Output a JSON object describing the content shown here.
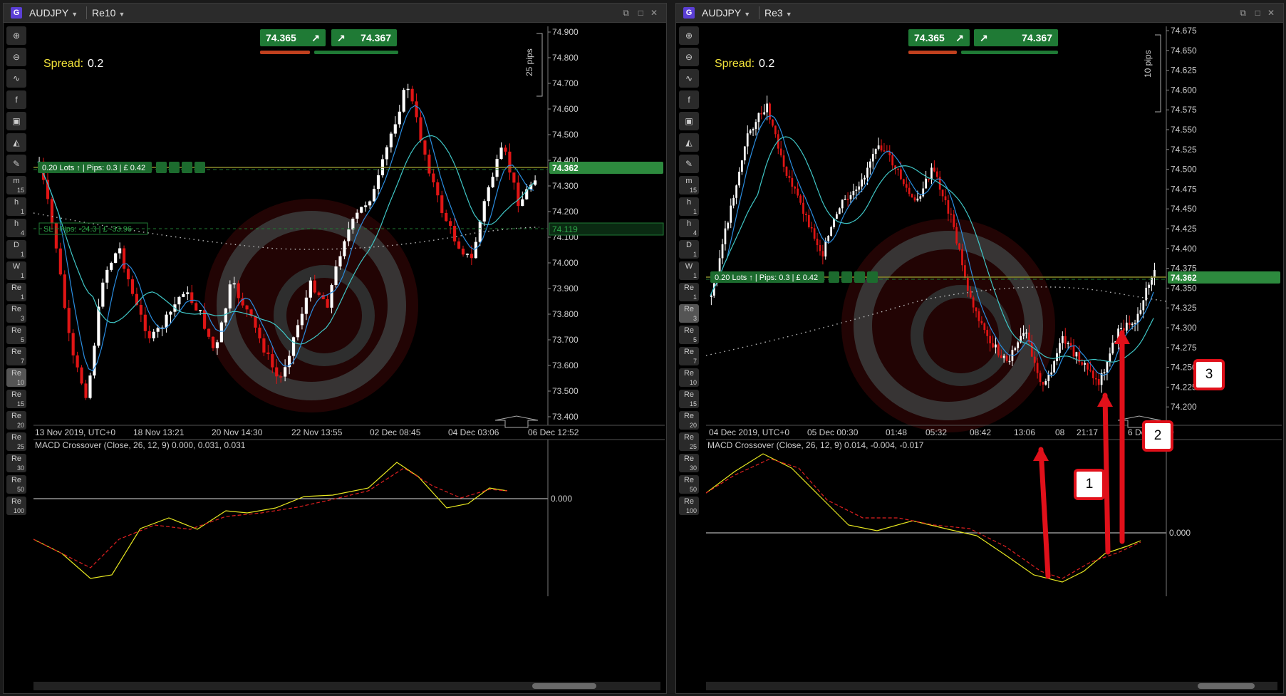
{
  "left": {
    "symbol": "AUDJPY",
    "timeframe": "Re10",
    "bid": "74.365",
    "ask": "74.367",
    "spread_label": "Spread:",
    "spread_value": "0.2",
    "pips_ruler": "25 pips",
    "price_ticks": [
      "74.900",
      "74.800",
      "74.700",
      "74.600",
      "74.500",
      "74.400",
      "74.300",
      "74.200",
      "74.100",
      "74.000",
      "73.900",
      "73.800",
      "73.700",
      "73.600",
      "73.500",
      "73.400"
    ],
    "time_labels": [
      "13 Nov 2019, UTC+0",
      "18 Nov 13:21",
      "20 Nov 14:30",
      "22 Nov 13:55",
      "02 Dec 08:45",
      "04 Dec 03:06",
      "06 Dec 12:52"
    ],
    "position_label": "0.20 Lots",
    "position_pips": "Pips: 0.3",
    "position_pnl": "£ 0.42",
    "current_price": "74.362",
    "sl_label": "SL",
    "sl_pips": "Pips: -24.3",
    "sl_pnl": "£ -33.96",
    "sl_price": "74.119",
    "macd_label": "MACD Crossover (Close, 26, 12, 9) 0.000, 0.031, 0.031",
    "macd_zero": "0.000"
  },
  "right": {
    "symbol": "AUDJPY",
    "timeframe": "Re3",
    "bid": "74.365",
    "ask": "74.367",
    "spread_label": "Spread:",
    "spread_value": "0.2",
    "pips_ruler": "10 pips",
    "price_ticks": [
      "74.675",
      "74.650",
      "74.625",
      "74.600",
      "74.575",
      "74.550",
      "74.525",
      "74.500",
      "74.475",
      "74.450",
      "74.425",
      "74.400",
      "74.375",
      "74.350",
      "74.325",
      "74.300",
      "74.275",
      "74.250",
      "74.225",
      "74.200"
    ],
    "time_labels": [
      "04 Dec 2019, UTC+0",
      "05 Dec 00:30",
      "01:48",
      "05:32",
      "08:42",
      "13:06",
      "08",
      "21:17",
      "6 Dec 00:50"
    ],
    "position_label": "0.20 Lots",
    "position_pips": "Pips: 0.3",
    "position_pnl": "£ 0.42",
    "current_price": "74.362",
    "macd_label": "MACD Crossover (Close, 26, 12, 9) 0.014, -0.004, -0.017",
    "macd_zero": "0.000",
    "callouts": [
      "1",
      "2",
      "3"
    ]
  },
  "toolbar": [
    "zoom-in",
    "zoom-out",
    "indicators",
    "facebook",
    "bot",
    "trader",
    "edit"
  ],
  "timeframe_buttons": [
    {
      "main": "m",
      "sub": "15"
    },
    {
      "main": "h",
      "sub": "1"
    },
    {
      "main": "h",
      "sub": "4"
    },
    {
      "main": "D",
      "sub": "1"
    },
    {
      "main": "W",
      "sub": "1"
    },
    {
      "main": "Re",
      "sub": "1"
    },
    {
      "main": "Re",
      "sub": "3"
    },
    {
      "main": "Re",
      "sub": "5"
    },
    {
      "main": "Re",
      "sub": "7"
    },
    {
      "main": "Re",
      "sub": "10"
    },
    {
      "main": "Re",
      "sub": "15"
    },
    {
      "main": "Re",
      "sub": "20"
    },
    {
      "main": "Re",
      "sub": "25"
    },
    {
      "main": "Re",
      "sub": "30"
    },
    {
      "main": "Re",
      "sub": "50"
    },
    {
      "main": "Re",
      "sub": "100"
    }
  ],
  "colors": {
    "up": "#ffffff",
    "down": "#e01515",
    "ma_fast": "#2a8de0",
    "ma_slow": "#3fc6c6",
    "macd": "#e8e820",
    "signal": "#e02020",
    "accent": "#1f7a35"
  }
}
